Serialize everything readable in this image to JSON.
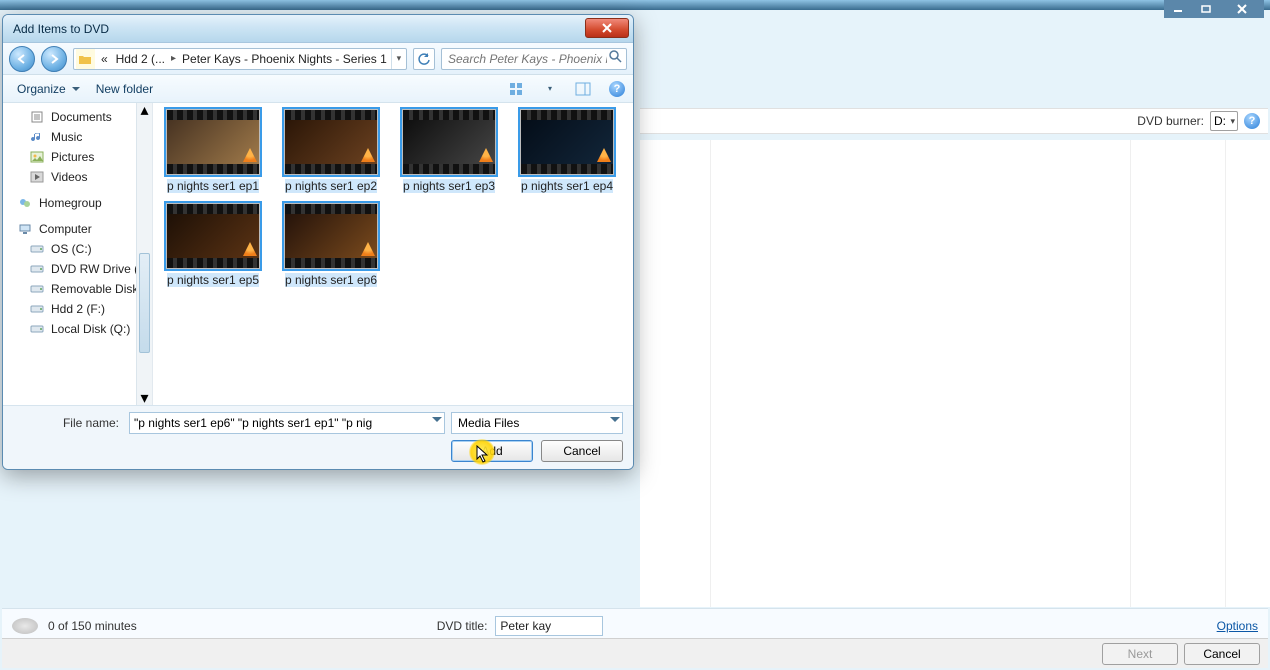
{
  "parentWindow": {
    "toolbar": {
      "dvdBurnerLabel": "DVD burner:",
      "dvdBurnerValue": "D:"
    },
    "status": {
      "minutes": "0 of 150 minutes",
      "dvdTitleLabel": "DVD title:",
      "dvdTitleValue": "Peter kay",
      "optionsLabel": "Options"
    },
    "footer": {
      "next": "Next",
      "cancel": "Cancel"
    }
  },
  "dialog": {
    "title": "Add Items to DVD",
    "breadcrumb": {
      "prefix": "«",
      "segments": [
        "Hdd 2 (...",
        "Peter Kays - Phoenix Nights - Series 1"
      ]
    },
    "search": {
      "placeholder": "Search Peter Kays - Phoenix Ni..."
    },
    "toolbar": {
      "organize": "Organize",
      "newFolder": "New folder"
    },
    "tree": {
      "libraries": [
        "Documents",
        "Music",
        "Pictures",
        "Videos"
      ],
      "homegroup": "Homegroup",
      "computer": "Computer",
      "drives": [
        "OS (C:)",
        "DVD RW Drive (D",
        "Removable Disk (",
        "Hdd 2 (F:)",
        "Local Disk (Q:)"
      ]
    },
    "files": [
      {
        "name": "p nights ser1 ep1",
        "selected": true,
        "cls": ""
      },
      {
        "name": "p nights ser1 ep2",
        "selected": true,
        "cls": "dark1"
      },
      {
        "name": "p nights ser1 ep3",
        "selected": true,
        "cls": "dark2"
      },
      {
        "name": "p nights ser1 ep4",
        "selected": true,
        "cls": "dark3"
      },
      {
        "name": "p nights ser1 ep5",
        "selected": true,
        "cls": "dark4"
      },
      {
        "name": "p nights ser1 ep6",
        "selected": true,
        "cls": "dark5"
      }
    ],
    "bottom": {
      "fileNameLabel": "File name:",
      "fileNameValue": "\"p nights ser1 ep6\" \"p nights ser1 ep1\" \"p nig",
      "filterValue": "Media Files",
      "addLabel": "Add",
      "cancelLabel": "Cancel"
    }
  }
}
